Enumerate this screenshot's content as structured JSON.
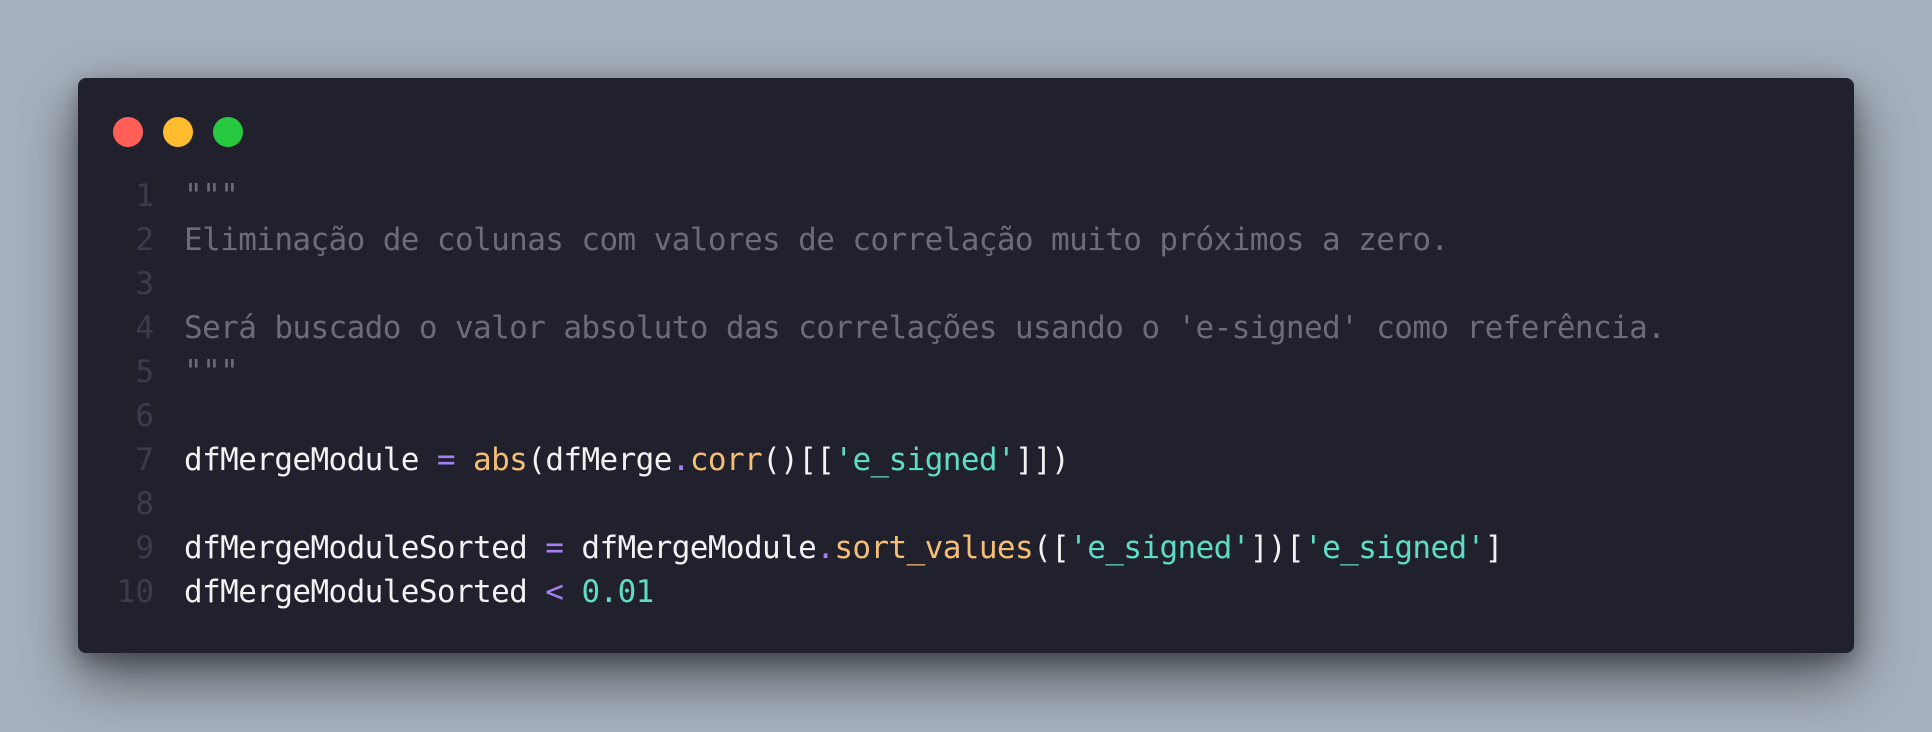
{
  "window": {
    "controls": [
      {
        "name": "close",
        "color": "#ff5f57"
      },
      {
        "name": "minimize",
        "color": "#febc2e"
      },
      {
        "name": "maximize",
        "color": "#28c840"
      }
    ]
  },
  "code": {
    "lines": [
      {
        "number": "1",
        "tokens": [
          {
            "text": "\"\"\"",
            "type": "comment"
          }
        ]
      },
      {
        "number": "2",
        "tokens": [
          {
            "text": "Eliminação de colunas com valores de correlação muito próximos a zero.",
            "type": "comment"
          }
        ]
      },
      {
        "number": "3",
        "tokens": []
      },
      {
        "number": "4",
        "tokens": [
          {
            "text": "Será buscado o valor absoluto das correlações usando o 'e-signed' como referência.",
            "type": "comment"
          }
        ]
      },
      {
        "number": "5",
        "tokens": [
          {
            "text": "\"\"\"",
            "type": "comment"
          }
        ]
      },
      {
        "number": "6",
        "tokens": []
      },
      {
        "number": "7",
        "tokens": [
          {
            "text": "dfMergeModule ",
            "type": "plain"
          },
          {
            "text": "=",
            "type": "op"
          },
          {
            "text": " ",
            "type": "plain"
          },
          {
            "text": "abs",
            "type": "fn"
          },
          {
            "text": "(dfMerge",
            "type": "plain"
          },
          {
            "text": ".",
            "type": "op"
          },
          {
            "text": "corr",
            "type": "fn"
          },
          {
            "text": "()[[",
            "type": "plain"
          },
          {
            "text": "'e_signed'",
            "type": "str"
          },
          {
            "text": "]])",
            "type": "plain"
          }
        ]
      },
      {
        "number": "8",
        "tokens": []
      },
      {
        "number": "9",
        "tokens": [
          {
            "text": "dfMergeModuleSorted ",
            "type": "plain"
          },
          {
            "text": "=",
            "type": "op"
          },
          {
            "text": " dfMergeModule",
            "type": "plain"
          },
          {
            "text": ".",
            "type": "op"
          },
          {
            "text": "sort_values",
            "type": "fn"
          },
          {
            "text": "([",
            "type": "plain"
          },
          {
            "text": "'e_signed'",
            "type": "str"
          },
          {
            "text": "])[",
            "type": "plain"
          },
          {
            "text": "'e_signed'",
            "type": "str"
          },
          {
            "text": "]",
            "type": "plain"
          }
        ]
      },
      {
        "number": "10",
        "tokens": [
          {
            "text": "dfMergeModuleSorted ",
            "type": "plain"
          },
          {
            "text": "<",
            "type": "op"
          },
          {
            "text": " ",
            "type": "plain"
          },
          {
            "text": "0.01",
            "type": "num"
          }
        ]
      }
    ]
  }
}
